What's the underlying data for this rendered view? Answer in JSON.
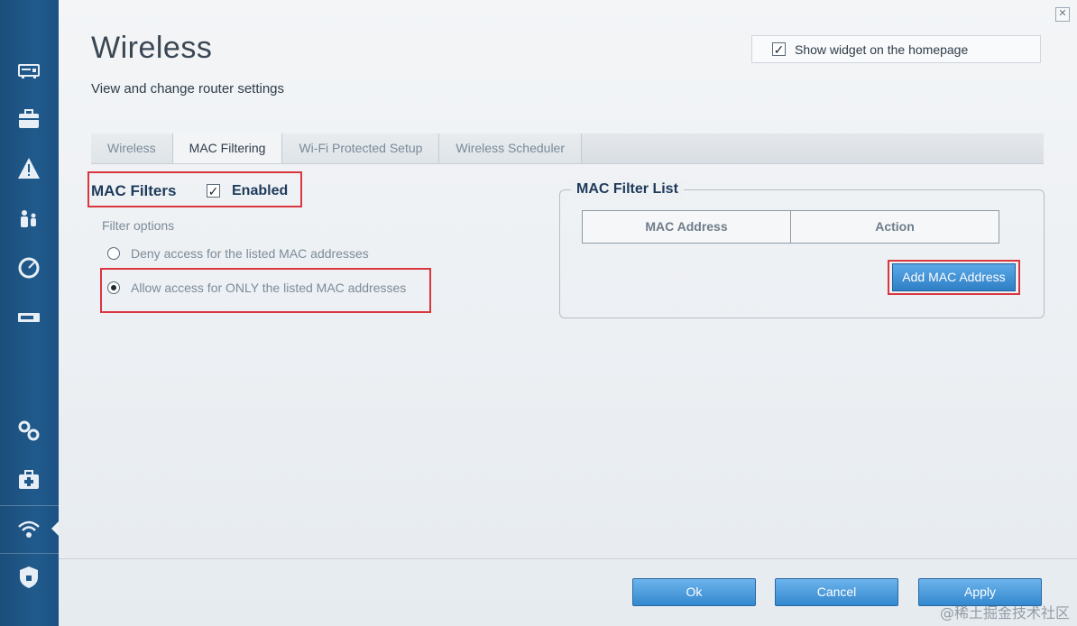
{
  "window": {
    "close_glyph": "✕"
  },
  "sidebar": {
    "icons": [
      {
        "name": "network-map-icon"
      },
      {
        "name": "toolbox-icon"
      },
      {
        "name": "troubleshooting-icon"
      },
      {
        "name": "parental-controls-icon"
      },
      {
        "name": "speed-test-icon"
      },
      {
        "name": "external-storage-icon"
      },
      {
        "name": "connectivity-icon"
      },
      {
        "name": "troubleshoot-kit-icon"
      },
      {
        "name": "wireless-icon",
        "active": true
      },
      {
        "name": "security-icon"
      }
    ]
  },
  "header": {
    "title": "Wireless",
    "subtitle": "View and change router settings",
    "widget": {
      "checked": true,
      "label": "Show widget on the homepage"
    }
  },
  "tabs": [
    {
      "label": "Wireless",
      "active": false
    },
    {
      "label": "MAC Filtering",
      "active": true
    },
    {
      "label": "Wi-Fi Protected Setup",
      "active": false
    },
    {
      "label": "Wireless Scheduler",
      "active": false
    }
  ],
  "mac_filters": {
    "label": "MAC Filters",
    "enabled_checked": true,
    "enabled_label": "Enabled",
    "filter_options_label": "Filter options",
    "options": [
      {
        "label": "Deny access for the listed MAC addresses",
        "selected": false
      },
      {
        "label": "Allow access for ONLY the listed MAC addresses",
        "selected": true
      }
    ]
  },
  "mac_filter_list": {
    "title": "MAC Filter List",
    "columns": [
      "MAC Address",
      "Action"
    ],
    "add_button_label": "Add MAC Address"
  },
  "footer": {
    "ok_label": "Ok",
    "cancel_label": "Cancel",
    "apply_label": "Apply"
  },
  "watermark": "@稀土掘金技术社区",
  "colors": {
    "sidebar": "#205a8c",
    "highlight": "#d9363e",
    "button": "#3388cf"
  }
}
